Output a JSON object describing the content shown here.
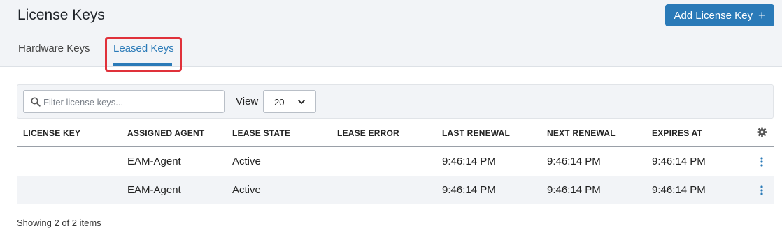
{
  "header": {
    "title": "License Keys",
    "add_button_label": "Add License Key",
    "add_button_icon": "plus-icon",
    "accent_color": "#2a7ab8",
    "highlight_color": "#e0313a"
  },
  "tabs": [
    {
      "label": "Hardware Keys",
      "active": false
    },
    {
      "label": "Leased Keys",
      "active": true
    }
  ],
  "toolbar": {
    "filter_placeholder": "Filter license keys...",
    "filter_value": "",
    "view_label": "View",
    "view_value": "20"
  },
  "table": {
    "columns": [
      "LICENSE KEY",
      "ASSIGNED AGENT",
      "LEASE STATE",
      "LEASE ERROR",
      "LAST RENEWAL",
      "NEXT RENEWAL",
      "EXPIRES AT"
    ],
    "rows": [
      {
        "license_key": "",
        "assigned_agent": "EAM-Agent",
        "lease_state": "Active",
        "lease_error": "",
        "last_renewal": "9:46:14 PM",
        "next_renewal": "9:46:14 PM",
        "expires_at": "9:46:14 PM"
      },
      {
        "license_key": "",
        "assigned_agent": "EAM-Agent",
        "lease_state": "Active",
        "lease_error": "",
        "last_renewal": "9:46:14 PM",
        "next_renewal": "9:46:14 PM",
        "expires_at": "9:46:14 PM"
      }
    ]
  },
  "footer": {
    "status": "Showing 2 of 2 items"
  }
}
